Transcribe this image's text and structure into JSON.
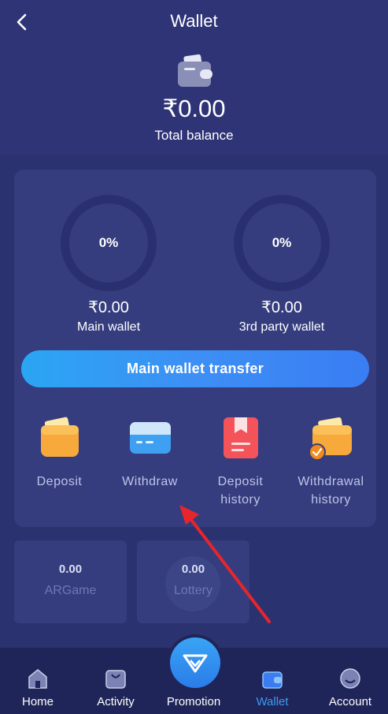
{
  "header": {
    "title": "Wallet",
    "back_icon": "chevron-left-icon",
    "total_amount": "₹0.00",
    "total_label": "Total balance"
  },
  "wallets": {
    "main": {
      "percent": "0%",
      "amount": "₹0.00",
      "label": "Main wallet"
    },
    "third_party": {
      "percent": "0%",
      "amount": "₹0.00",
      "label": "3rd party wallet"
    }
  },
  "transfer_button": "Main wallet transfer",
  "actions": [
    {
      "label": "Deposit",
      "icon": "deposit-wallet-icon"
    },
    {
      "label": "Withdraw",
      "icon": "credit-card-icon"
    },
    {
      "label": "Deposit\nhistory",
      "icon": "deposit-history-icon"
    },
    {
      "label": "Withdrawal\nhistory",
      "icon": "withdrawal-history-icon"
    }
  ],
  "games": [
    {
      "value": "0.00",
      "name": "ARGame"
    },
    {
      "value": "0.00",
      "name": "Lottery"
    }
  ],
  "tabs": [
    {
      "label": "Home",
      "icon": "home-icon"
    },
    {
      "label": "Activity",
      "icon": "activity-bag-icon"
    },
    {
      "label": "Promotion",
      "icon": "diamond-icon"
    },
    {
      "label": "Wallet",
      "icon": "wallet-icon",
      "active": true
    },
    {
      "label": "Account",
      "icon": "account-icon"
    }
  ],
  "colors": {
    "background": "#2b3270",
    "card": "#353d7e",
    "accent_blue": "#3a9bf5",
    "arrow_red": "#e8252b"
  }
}
